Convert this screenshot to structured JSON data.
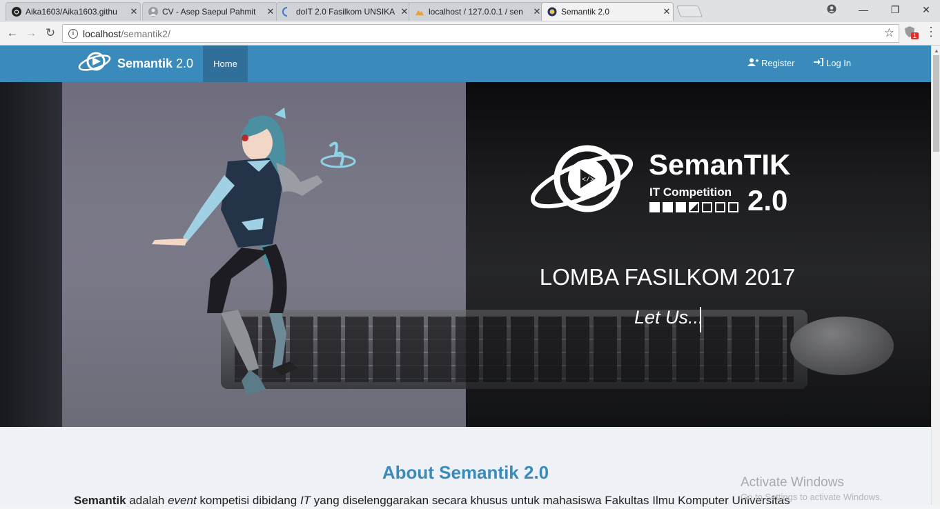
{
  "browser": {
    "tabs": [
      {
        "title": "Aika1603/Aika1603.githu",
        "icon": "github-icon"
      },
      {
        "title": "CV - Asep Saepul Pahmit",
        "icon": "avatar-icon"
      },
      {
        "title": "doIT 2.0 Fasilkom UNSIKA",
        "icon": "loading-icon"
      },
      {
        "title": "localhost / 127.0.0.1 / sen",
        "icon": "phpmyadmin-icon"
      },
      {
        "title": "Semantik 2.0",
        "icon": "semantik-favicon"
      }
    ],
    "active_tab": 4,
    "close_glyph": "✕",
    "url_host": "localhost",
    "url_path": "/semantik2/",
    "extension_badge": "1"
  },
  "navbar": {
    "brand": "Semantik",
    "brand_version": "2.0",
    "home": "Home",
    "register": "Register",
    "login": "Log In",
    "color": "#3a8bbb"
  },
  "hero": {
    "logo_name": "SemanTIK",
    "logo_tagline": "IT Competition",
    "logo_version": "2.0",
    "title": "LOMBA FASILKOM 2017",
    "subtitle": "Let Us..."
  },
  "about": {
    "title": "About Semantik 2.0",
    "text_bold": "Semantik",
    "text_1": " adalah ",
    "text_em1": "event",
    "text_2": " kompetisi dibidang ",
    "text_em2": "IT",
    "text_3": " yang diselenggarakan secara khusus untuk mahasiswa Fakultas Ilmu Komputer Universitas"
  },
  "watermark": {
    "title": "Activate Windows",
    "subtitle": "Go to Settings to activate Windows."
  }
}
